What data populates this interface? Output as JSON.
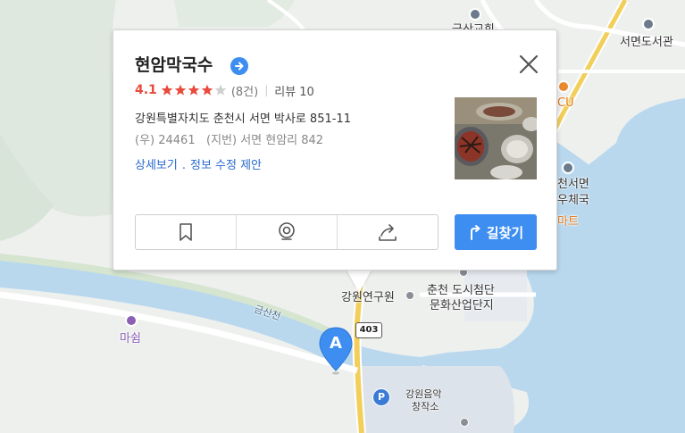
{
  "map": {
    "labels": {
      "library": "서면도서관",
      "post_office_1": "천서면",
      "post_office_2": "우체국",
      "mart": "마트",
      "cu": "CU",
      "research": "강원연구원",
      "culture_1": "춘천 도시첨단",
      "culture_2": "문화산업단지",
      "music_1": "강원음악",
      "music_2": "창작소",
      "stream": "금산천",
      "masim": "마쉼",
      "top_label": "금산교회"
    },
    "route_number": "403",
    "parking_label": "P",
    "marker_letter": "A",
    "colors": {
      "water": "#b9d8ee",
      "land": "#eef0ee",
      "green": "#dfe8df",
      "road_yellow": "#f2cf5a",
      "road_white": "#ffffff",
      "marker": "#3d8ef0"
    }
  },
  "place": {
    "name": "현암막국수",
    "rating": "4.1",
    "stars_filled": 4,
    "stars_total": 5,
    "review_count": "(8건)",
    "review_label": "리뷰 10",
    "address": "강원특별자치도 춘천시 서면 박사로 851-11",
    "postal": "(우) 24461",
    "jibun": "(지번) 서면 현암리 842",
    "link_detail": "상세보기",
    "link_dot": ".",
    "link_edit": "정보 수정 제안",
    "directions_label": "길찾기"
  },
  "icons": {
    "title_arrow": "arrow-right-icon",
    "close": "close-icon",
    "bookmark": "bookmark-icon",
    "roadview": "roadview-icon",
    "share": "share-icon",
    "directions": "directions-icon"
  }
}
